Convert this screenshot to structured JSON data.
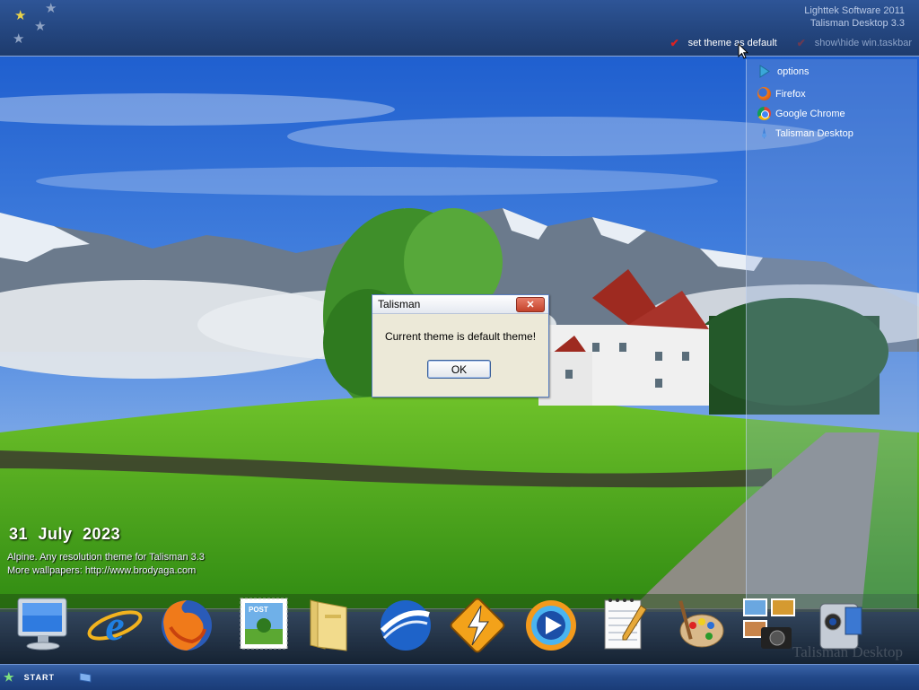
{
  "header": {
    "brand_line1": "Lighttek Software 2011",
    "brand_line2": "Talisman Desktop 3.3",
    "set_default_label": "set theme as default",
    "toggle_taskbar_label": "show\\hide win.taskbar"
  },
  "side_panel": {
    "options_label": "options",
    "items": [
      {
        "label": "Firefox",
        "icon": "firefox-icon"
      },
      {
        "label": "Google Chrome",
        "icon": "chrome-icon"
      },
      {
        "label": "Talisman Desktop",
        "icon": "talisman-icon"
      }
    ]
  },
  "desktop": {
    "date": "31  July  2023",
    "theme_info_line1": "Alpine. Any resolution theme for Talisman 3.3",
    "theme_info_line2": "More wallpapers: http://www.brodyaga.com"
  },
  "dock": {
    "watermark": "Talisman Desktop",
    "items": [
      "my-computer-icon",
      "internet-explorer-icon",
      "firefox-icon",
      "mail-stamp-icon",
      "folder-icon",
      "google-earth-icon",
      "winamp-icon",
      "media-player-icon",
      "notepad-icon",
      "paint-icon",
      "photo-gallery-icon",
      "camcorder-icon"
    ]
  },
  "taskbar": {
    "start_label": "START"
  },
  "dialog": {
    "title": "Talisman",
    "close_label": "✕",
    "message": "Current theme is default theme!",
    "ok_label": "OK"
  },
  "colors": {
    "banner": "#24467f",
    "taskbar": "#224889",
    "dialog_bg": "#ece9d8",
    "close_red": "#c4422b"
  }
}
